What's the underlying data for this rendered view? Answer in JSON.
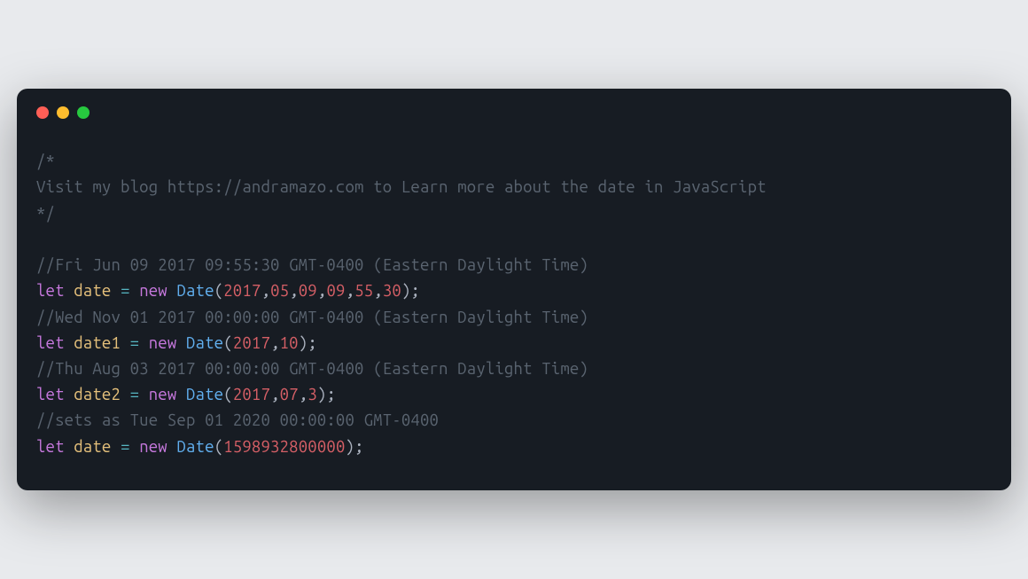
{
  "comment_block": {
    "open": "/*",
    "line": "Visit my blog https://andramazo.com to Learn more about the date in JavaScript",
    "close": "*/"
  },
  "lines": {
    "c1": "//Fri Jun 09 2017 09:55:30 GMT-0400 (Eastern Daylight Time)",
    "l1": {
      "let": "let",
      "name": "date",
      "eq": "=",
      "new": "new",
      "cls": "Date",
      "lp": "(",
      "a0": "2017",
      "comma": ",",
      "a1": "05",
      "a2": "09",
      "a3": "09",
      "a4": "55",
      "a5": "30",
      "rp": ")",
      "semi": ";"
    },
    "c2": "//Wed Nov 01 2017 00:00:00 GMT-0400 (Eastern Daylight Time)",
    "l2": {
      "let": "let",
      "name": "date1",
      "eq": "=",
      "new": "new",
      "cls": "Date",
      "lp": "(",
      "a0": "2017",
      "comma": ",",
      "a1": "10",
      "rp": ")",
      "semi": ";"
    },
    "c3": "//Thu Aug 03 2017 00:00:00 GMT-0400 (Eastern Daylight Time)",
    "l3": {
      "let": "let",
      "name": "date2",
      "eq": "=",
      "new": "new",
      "cls": "Date",
      "lp": "(",
      "a0": "2017",
      "comma": ",",
      "a1": "07",
      "a2": "3",
      "rp": ")",
      "semi": ";"
    },
    "c4": "//sets as Tue Sep 01 2020 00:00:00 GMT-0400",
    "l4": {
      "let": "let",
      "name": "date",
      "eq": "=",
      "new": "new",
      "cls": "Date",
      "lp": "(",
      "a0": "1598932800000",
      "rp": ")",
      "semi": ";"
    }
  },
  "space": " "
}
